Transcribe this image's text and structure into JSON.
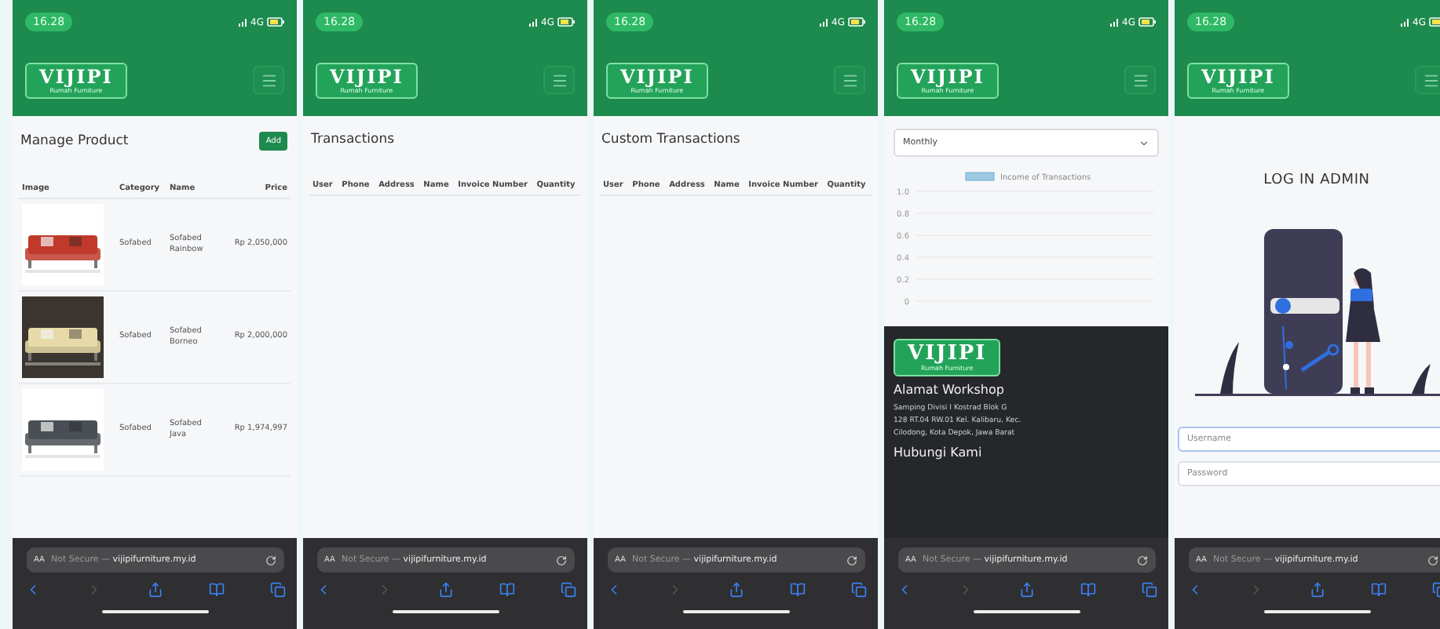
{
  "phones": [
    {
      "kind": "products",
      "status": {
        "time": "16.28",
        "network": "4G"
      },
      "logo": {
        "title": "VIJIPI",
        "subtitle": "Rumah Furniture"
      },
      "browser": {
        "text_size": "AA",
        "security": "Not Secure —",
        "domain": "vijipifurniture.my.id"
      },
      "page": {
        "title": "Manage Product",
        "add_button": "Add",
        "columns": [
          "Image",
          "Category",
          "Name",
          "Price"
        ],
        "rows": [
          {
            "category": "Sofabed",
            "name": "Sofabed Rainbow",
            "price": "Rp 2,050,000"
          },
          {
            "category": "Sofabed",
            "name": "Sofabed Borneo",
            "price": "Rp 2,000,000"
          },
          {
            "category": "Sofabed",
            "name": "Sofabed Java",
            "price": "Rp 1,974,997"
          }
        ]
      }
    },
    {
      "kind": "transactions",
      "status": {
        "time": "16.28",
        "network": "4G"
      },
      "logo": {
        "title": "VIJIPI",
        "subtitle": "Rumah Furniture"
      },
      "browser": {
        "text_size": "AA",
        "security": "Not Secure —",
        "domain": "vijipifurniture.my.id"
      },
      "page": {
        "title": "Transactions",
        "columns": [
          "User",
          "Phone",
          "Address",
          "Name",
          "Invoice Number",
          "Quantity"
        ]
      }
    },
    {
      "kind": "transactions",
      "status": {
        "time": "16.28",
        "network": "4G"
      },
      "logo": {
        "title": "VIJIPI",
        "subtitle": "Rumah Furniture"
      },
      "browser": {
        "text_size": "AA",
        "security": "Not Secure —",
        "domain": "vijipifurniture.my.id"
      },
      "page": {
        "title": "Custom Transactions",
        "columns": [
          "User",
          "Phone",
          "Address",
          "Name",
          "Invoice Number",
          "Quantity"
        ]
      }
    },
    {
      "kind": "chart",
      "status": {
        "time": "16.28",
        "network": "4G"
      },
      "logo": {
        "title": "VIJIPI",
        "subtitle": "Rumah Furniture"
      },
      "browser": {
        "text_size": "AA",
        "security": "Not Secure —",
        "domain": "vijipifurniture.my.id"
      },
      "page": {
        "period_select": "Monthly",
        "chart_data": {
          "type": "bar",
          "grid": true,
          "ylim": [
            0,
            1
          ],
          "yticks": [
            0,
            0.2,
            0.4,
            0.6,
            0.8,
            {
              "value": 1,
              "label": "1.0"
            }
          ],
          "series": [
            {
              "name": "Income of Transactions",
              "color": "#9ecae1"
            }
          ]
        },
        "footer": {
          "logo": {
            "title": "VIJIPI",
            "subtitle": "Rumah Furniture"
          },
          "address_heading": "Alamat Workshop",
          "address": "Samping Divisi I Kostrad Blok G 128 RT.04 RW.01 Kel. Kalibaru, Kec. Cilodong, Kota Depok, Jawa Barat",
          "contact_heading": "Hubungi Kami"
        }
      }
    },
    {
      "kind": "login",
      "status": {
        "time": "16.28",
        "network": "4G"
      },
      "logo": {
        "title": "VIJIPI",
        "subtitle": "Rumah Furniture"
      },
      "browser": {
        "text_size": "AA",
        "security": "Not Secure —",
        "domain": "vijipifurniture.my.id"
      },
      "page": {
        "title": "LOG IN ADMIN",
        "username_placeholder": "Username",
        "password_placeholder": "Password"
      }
    }
  ]
}
